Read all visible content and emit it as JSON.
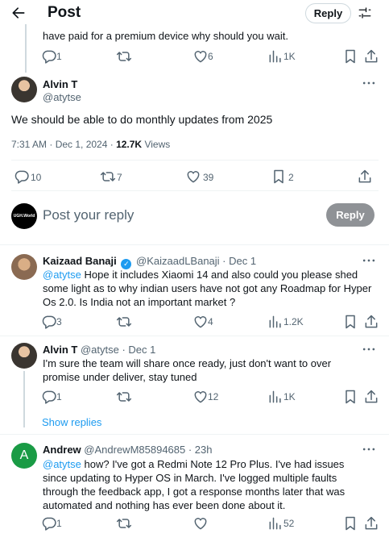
{
  "header": {
    "title": "Post",
    "reply_button": "Reply"
  },
  "prev_tweet": {
    "text_tail": "have paid for  a premium device why should you wait.",
    "stats": {
      "replies": "1",
      "likes": "6",
      "views": "1K"
    }
  },
  "main_tweet": {
    "name": "Alvin T",
    "handle": "@atytse",
    "text": "We should be able to do monthly updates from 2025",
    "time": "7:31 AM · Dec 1, 2024 · ",
    "views_count": "12.7K",
    "views_label": " Views",
    "stats": {
      "replies": "10",
      "reposts": "7",
      "likes": "39",
      "bookmarks": "2"
    }
  },
  "composer": {
    "avatar_text": "UGH.World",
    "placeholder": "Post your reply",
    "button": "Reply"
  },
  "replies": [
    {
      "name": "Kaizaad Banaji",
      "handle": "@KaizaadLBanaji",
      "date": " · Dec 1",
      "mention": "@atytse",
      "text": " Hope it includes Xiaomi 14 and also could you please shed some light as to why indian users have not got any Roadmap for Hyper Os 2.0.  Is India not an important market ?",
      "stats": {
        "replies": "3",
        "likes": "4",
        "views": "1.2K"
      }
    },
    {
      "name": "Alvin T",
      "handle": "@atytse",
      "date": " · Dec 1",
      "text": "I'm sure the team will share once ready, just don't want to over promise under deliver, stay tuned",
      "stats": {
        "replies": "1",
        "likes": "12",
        "views": "1K"
      },
      "show_replies": "Show replies"
    },
    {
      "avatar_letter": "A",
      "name": "Andrew",
      "handle": "@AndrewM85894685",
      "date": " · 23h",
      "mention": "@atytse",
      "text": " how? I've got a Redmi Note 12 Pro Plus. I've had issues since updating to Hyper OS in March. I've logged multiple faults through the feedback app, I got a response months later that was automated and nothing has ever been done about it.",
      "stats": {
        "replies": "1",
        "views": "52"
      }
    }
  ],
  "colors": {
    "accent": "#1d9bf0",
    "text": "#0f1419",
    "muted": "#536471",
    "border": "#eff3f4",
    "avatar_green": "#1a9b45"
  }
}
